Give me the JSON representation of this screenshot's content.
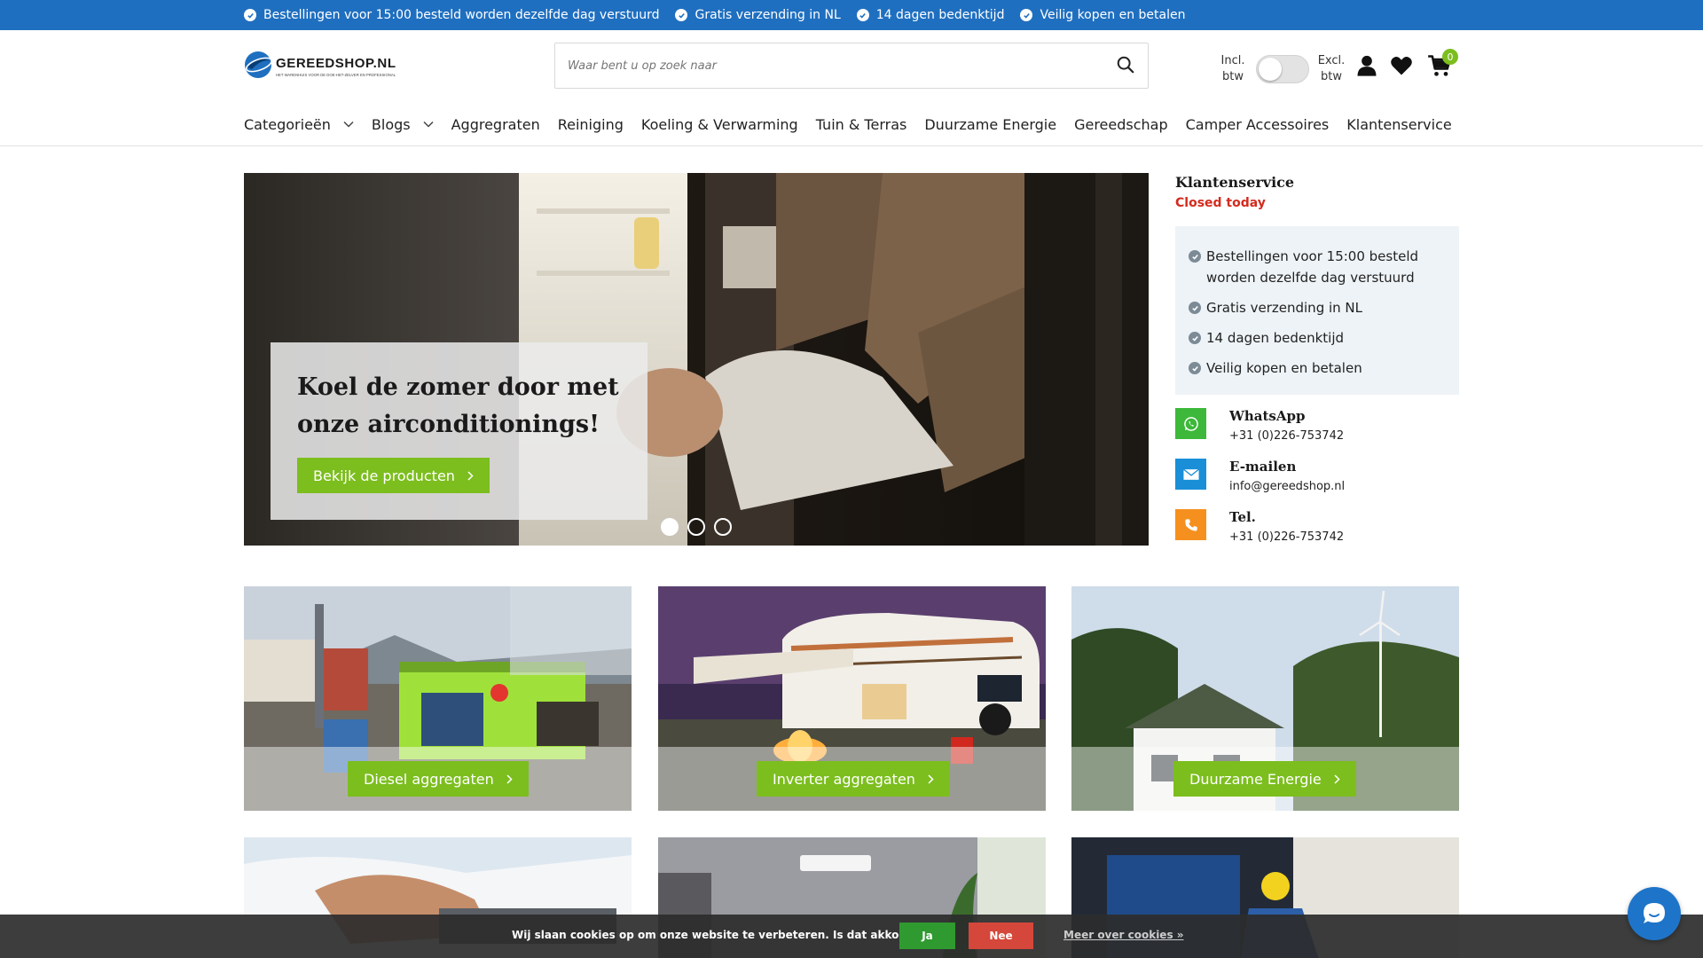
{
  "topbar": {
    "usps": [
      "Bestellingen voor 15:00 besteld worden dezelfde dag verstuurd",
      "Gratis verzending in NL",
      "14 dagen bedenktijd",
      "Veilig kopen en betalen"
    ]
  },
  "header": {
    "logo_text": "GEREEDSHOP.NL",
    "logo_tagline": "HET WARENHUIS VOOR DE DOE-HET-ZELVER EN PROFESSIONAL",
    "search_placeholder": "Waar bent u op zoek naar",
    "vat_incl_line1": "Incl.",
    "vat_incl_line2": "btw",
    "vat_excl_line1": "Excl.",
    "vat_excl_line2": "btw",
    "cart_count": "0"
  },
  "nav": {
    "items": [
      {
        "label": "Categorieën",
        "dropdown": true
      },
      {
        "label": "Blogs",
        "dropdown": true
      },
      {
        "label": "Aggregraten",
        "dropdown": false
      },
      {
        "label": "Reiniging",
        "dropdown": false
      },
      {
        "label": "Koeling & Verwarming",
        "dropdown": false
      },
      {
        "label": "Tuin & Terras",
        "dropdown": false
      },
      {
        "label": "Duurzame Energie",
        "dropdown": false
      },
      {
        "label": "Gereedschap",
        "dropdown": false
      },
      {
        "label": "Camper Accessoires",
        "dropdown": false
      },
      {
        "label": "Klantenservice",
        "dropdown": false
      }
    ]
  },
  "hero": {
    "title": "Koel de zomer door met onze airconditionings!",
    "button": "Bekijk de producten",
    "slides": 3,
    "active_slide": 1
  },
  "sidebar": {
    "title": "Klantenservice",
    "status": "Closed today",
    "usps": [
      "Bestellingen voor 15:00 besteld worden dezelfde dag verstuurd",
      "Gratis verzending in NL",
      "14 dagen bedenktijd",
      "Veilig kopen en betalen"
    ],
    "contacts": [
      {
        "label": "WhatsApp",
        "value": "+31 (0)226-753742",
        "icon": "whatsapp-icon",
        "color": "#3db83a"
      },
      {
        "label": "E-mailen",
        "value": "info@gereedshop.nl",
        "icon": "mail-icon",
        "color": "#1a8fd8"
      },
      {
        "label": "Tel.",
        "value": "+31 (0)226-753742",
        "icon": "phone-icon",
        "color": "#f5901e"
      }
    ]
  },
  "tiles": [
    {
      "label": "Diesel aggregaten"
    },
    {
      "label": "Inverter aggregaten"
    },
    {
      "label": "Duurzame Energie"
    }
  ],
  "cookie": {
    "text": "Wij slaan cookies op om onze website te verbeteren. Is dat akkoord?",
    "yes": "Ja",
    "no": "Nee",
    "more": "Meer over cookies »"
  },
  "colors": {
    "topbar": "#1f6fc0",
    "accent_green": "#7cbe1e",
    "closed_red": "#d32b1e",
    "cookie_yes": "#2f9a2f",
    "cookie_no": "#d5473a"
  }
}
